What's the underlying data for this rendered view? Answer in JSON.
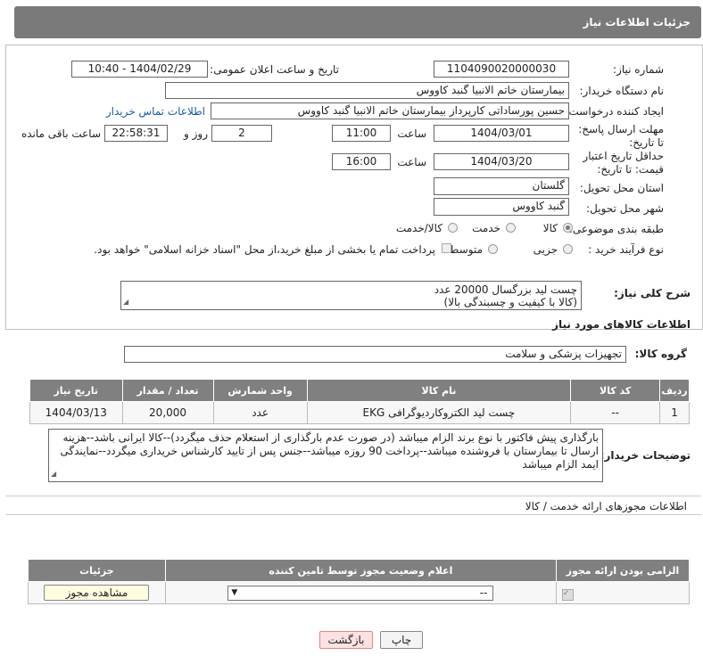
{
  "header": {
    "title": "جزئیات اطلاعات نیاز"
  },
  "form": {
    "need_number_label": "شماره نیاز:",
    "need_number": "1104090020000030",
    "announce_label": "تاریخ و ساعت اعلان عمومی:",
    "announce_value": "1404/02/29 - 10:40",
    "buyer_org_label": "نام دستگاه خریدار:",
    "buyer_org": "بیمارستان خاتم الانبیا گنبد کاووس",
    "creator_label": "ایجاد کننده درخواست:",
    "creator": "حسین پورساداتی کارپرداز بیمارستان خاتم الانبیا گنبد کاووس",
    "contact_link": "اطلاعات تماس خریدار",
    "reply_deadline_label": "مهلت ارسال پاسخ: تا تاریخ:",
    "reply_date": "1404/03/01",
    "time_label": "ساعت",
    "reply_time": "11:00",
    "days_value": "2",
    "days_label": "روز و",
    "remaining_time": "22:58:31",
    "remaining_label": "ساعت باقی مانده",
    "price_validity_label": "حداقل تاریخ اعتبار قیمت: تا تاریخ:",
    "price_date": "1404/03/20",
    "price_time": "16:00",
    "province_label": "استان محل تحویل:",
    "province": "گلستان",
    "city_label": "شهر محل تحویل:",
    "city": "گنبد کاووس",
    "category_label": "طبقه بندی موضوعی:",
    "category_options": {
      "goods": "کالا",
      "service": "خدمت",
      "goods_service": "کالا/خدمت"
    },
    "process_label": "نوع فرآیند خرید :",
    "process_options": {
      "minor": "جزیی",
      "medium": "متوسط"
    },
    "payment_note": "پرداخت تمام یا بخشی از مبلغ خرید،از محل \"اسناد خزانه اسلامی\" خواهد بود."
  },
  "summary": {
    "label": "شرح کلی نیاز:",
    "line1": "چست لید بزرگسال 20000 عدد",
    "line2": "(کالا با کیفیت و چسبندگی بالا)"
  },
  "goods_info": {
    "title": "اطلاعات کالاهای مورد نیاز",
    "group_label": "گروه کالا:",
    "group_value": "تجهیزات پزشکی و سلامت"
  },
  "items_table": {
    "headers": [
      "ردیف",
      "کد کالا",
      "نام کالا",
      "واحد شمارش",
      "تعداد / مقدار",
      "تاریخ نیاز"
    ],
    "rows": [
      {
        "row": "1",
        "code": "--",
        "name": "چست لید الکتروکاردیوگرافی EKG",
        "unit": "عدد",
        "qty": "20,000",
        "date": "1404/03/13"
      }
    ]
  },
  "buyer_notes": {
    "label": "توضیحات خریدار:",
    "line1": "بارگذاری پیش فاکتور با نوع برند الزام میباشد (در صورت عدم بارگذاری از استعلام حذف میگردد)--کالا ایرانی باشد--هزینه",
    "line2": "ارسال تا بیمارستان با فروشنده میباشد--پرداخت 90 روزه میباشد--جنس پس از تایید کارشناس خریداری میگردد--نمایندگی",
    "line3": "ایمد الزام میباشد"
  },
  "permits": {
    "title": "اطلاعات مجوزهای ارائه خدمت / کالا",
    "headers": [
      "الزامی بودن ارائه مجوز",
      "اعلام وضعیت مجوز توسط تامین کننده",
      "جزئیات"
    ],
    "select_value": "--",
    "view_button": "مشاهده مجوز"
  },
  "footer": {
    "print_button": "چاپ",
    "back_button": "بازگشت"
  }
}
